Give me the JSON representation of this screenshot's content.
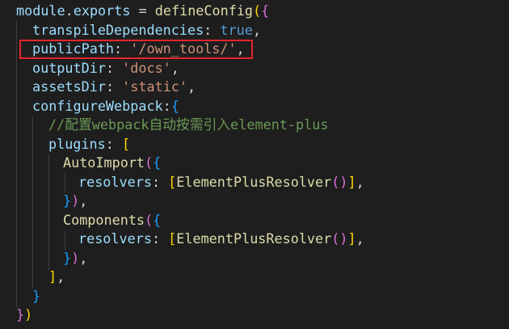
{
  "lines": [
    {
      "id": "l1",
      "tokens": [
        [
          "module",
          "var"
        ],
        [
          ".",
          "punc"
        ],
        [
          "exports",
          "var"
        ],
        [
          " = ",
          "punc"
        ],
        [
          "defineConfig",
          "fn"
        ],
        [
          "(",
          "b1"
        ],
        [
          "{",
          "b2"
        ]
      ]
    },
    {
      "id": "l2",
      "tokens": [
        [
          "transpileDependencies",
          "var"
        ],
        [
          ": ",
          "punc"
        ],
        [
          "true",
          "kw"
        ],
        [
          ",",
          "punc"
        ]
      ]
    },
    {
      "id": "l3",
      "tokens": [
        [
          "publicPath",
          "var"
        ],
        [
          ": ",
          "punc"
        ],
        [
          "'/own_tools/'",
          "str"
        ],
        [
          ",",
          "punc"
        ]
      ]
    },
    {
      "id": "l4",
      "tokens": [
        [
          "outputDir",
          "var"
        ],
        [
          ": ",
          "punc"
        ],
        [
          "'docs'",
          "str"
        ],
        [
          ",",
          "punc"
        ]
      ]
    },
    {
      "id": "l5",
      "tokens": [
        [
          "assetsDir",
          "var"
        ],
        [
          ": ",
          "punc"
        ],
        [
          "'static'",
          "str"
        ],
        [
          ",",
          "punc"
        ]
      ]
    },
    {
      "id": "l6",
      "tokens": [
        [
          "configureWebpack",
          "var"
        ],
        [
          ":",
          "punc"
        ],
        [
          "{",
          "b3"
        ]
      ]
    },
    {
      "id": "l7",
      "tokens": [
        [
          "//配置webpack自动按需引入element-plus",
          "cmt"
        ]
      ]
    },
    {
      "id": "l8",
      "tokens": [
        [
          "plugins",
          "var"
        ],
        [
          ": ",
          "punc"
        ],
        [
          "[",
          "b1"
        ]
      ]
    },
    {
      "id": "l9",
      "tokens": [
        [
          "AutoImport",
          "fn"
        ],
        [
          "(",
          "b2"
        ],
        [
          "{",
          "b3"
        ]
      ]
    },
    {
      "id": "l10",
      "tokens": [
        [
          "resolvers",
          "var"
        ],
        [
          ": ",
          "punc"
        ],
        [
          "[",
          "b1"
        ],
        [
          "ElementPlusResolver",
          "fn"
        ],
        [
          "(",
          "b2"
        ],
        [
          ")",
          "b2"
        ],
        [
          "]",
          "b1"
        ],
        [
          ",",
          "punc"
        ]
      ]
    },
    {
      "id": "l11",
      "tokens": [
        [
          "}",
          "b3"
        ],
        [
          ")",
          "b2"
        ],
        [
          ",",
          "punc"
        ]
      ]
    },
    {
      "id": "l12",
      "tokens": [
        [
          "Components",
          "fn"
        ],
        [
          "(",
          "b2"
        ],
        [
          "{",
          "b3"
        ]
      ]
    },
    {
      "id": "l13",
      "tokens": [
        [
          "resolvers",
          "var"
        ],
        [
          ": ",
          "punc"
        ],
        [
          "[",
          "b1"
        ],
        [
          "ElementPlusResolver",
          "fn"
        ],
        [
          "(",
          "b2"
        ],
        [
          ")",
          "b2"
        ],
        [
          "]",
          "b1"
        ],
        [
          ",",
          "punc"
        ]
      ]
    },
    {
      "id": "l14",
      "tokens": [
        [
          "}",
          "b3"
        ],
        [
          ")",
          "b2"
        ],
        [
          ",",
          "punc"
        ]
      ]
    },
    {
      "id": "l15",
      "tokens": [
        [
          "]",
          "b1"
        ],
        [
          ",",
          "punc"
        ]
      ]
    },
    {
      "id": "l16",
      "tokens": [
        [
          "}",
          "b3"
        ]
      ]
    },
    {
      "id": "l17",
      "tokens": [
        [
          "}",
          "b2"
        ],
        [
          ")",
          "b1"
        ]
      ]
    }
  ]
}
